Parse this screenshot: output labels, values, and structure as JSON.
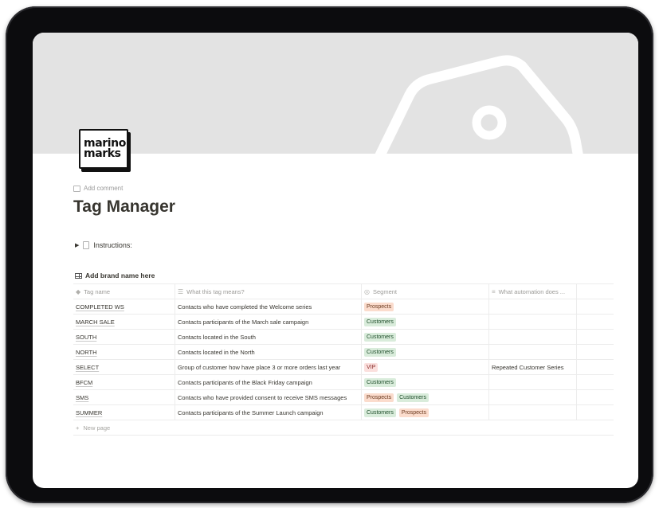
{
  "logo": {
    "line1": "marino",
    "line2": "marks"
  },
  "page": {
    "add_comment": "Add comment",
    "title": "Tag Manager",
    "toggle_label": "Instructions:"
  },
  "database": {
    "title": "Add brand name here",
    "columns": [
      "Tag name",
      "What this tag means?",
      "Segment",
      "What automation does ..."
    ],
    "rows": [
      {
        "name": "COMPLETED WS",
        "meaning": "Contacts who have completed the Welcome series",
        "segments": [
          "Prospects"
        ],
        "automation": ""
      },
      {
        "name": "MARCH SALE",
        "meaning": "Contacts participants of the March sale campaign",
        "segments": [
          "Customers"
        ],
        "automation": ""
      },
      {
        "name": "SOUTH",
        "meaning": "Contacts located in the South",
        "segments": [
          "Customers"
        ],
        "automation": ""
      },
      {
        "name": "NORTH",
        "meaning": "Contacts located in the North",
        "segments": [
          "Customers"
        ],
        "automation": ""
      },
      {
        "name": "SELECT",
        "meaning": "Group of customer how have place 3 or more orders last year",
        "segments": [
          "VIP"
        ],
        "automation": "Repeated Customer Series"
      },
      {
        "name": "BFCM",
        "meaning": "Contacts participants of the Black Friday campaign",
        "segments": [
          "Customers"
        ],
        "automation": ""
      },
      {
        "name": "SMS",
        "meaning": "Contacts who have provided consent to receive SMS messages",
        "segments": [
          "Prospects",
          "Customers"
        ],
        "automation": ""
      },
      {
        "name": "SUMMER",
        "meaning": "Contacts participants of the Summer Launch campaign",
        "segments": [
          "Customers",
          "Prospects"
        ],
        "automation": ""
      }
    ],
    "new_page": "New page"
  },
  "colors": {
    "prospects_bg": "#fbdccd",
    "customers_bg": "#d9ecdb",
    "vip_bg": "#fbe0de",
    "cover_bg": "#e3e3e3"
  }
}
